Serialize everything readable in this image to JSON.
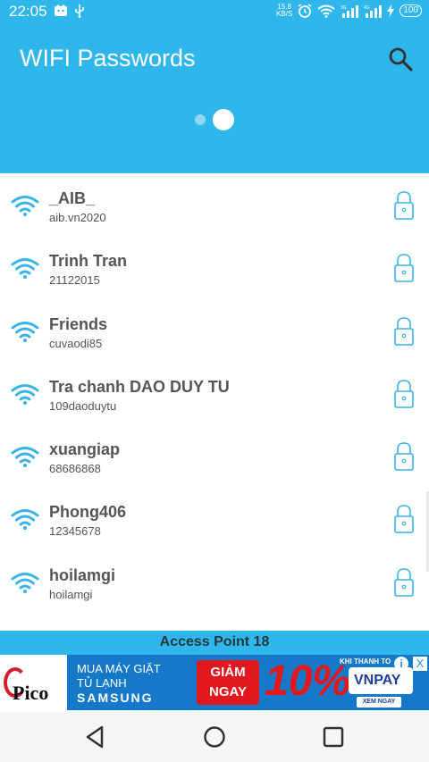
{
  "status_bar": {
    "time": "22:05",
    "net_speed_value": "15.8",
    "net_speed_unit": "KB/S",
    "battery": "100",
    "icons": [
      "notification-icon",
      "usb-icon",
      "alarm-icon",
      "wifi-icon",
      "signal-3g-icon",
      "signal-4g-icon",
      "charging-icon"
    ]
  },
  "app_bar": {
    "title": "WIFI Passwords",
    "pager": {
      "count": 2,
      "active_index": 1
    }
  },
  "networks": [
    {
      "name": "_AIB_",
      "password": "aib.vn2020"
    },
    {
      "name": "Trinh Tran",
      "password": "21122015"
    },
    {
      "name": "Friends",
      "password": "cuvaodi85"
    },
    {
      "name": "Tra chanh DAO DUY TU",
      "password": "109daoduytu"
    },
    {
      "name": "xuangiap",
      "password": "68686868"
    },
    {
      "name": "Phong406",
      "password": "12345678"
    },
    {
      "name": "hoilamgi",
      "password": "hoilamgi"
    }
  ],
  "footer": {
    "label": "Access Point 18"
  },
  "ad": {
    "logo": "Pico",
    "line1": "MUA MÁY GIẶT",
    "line2": "TỦ LẠNH",
    "brand": "SAMSUNG",
    "deal_line1": "GIẢM",
    "deal_line2": "NGAY",
    "percent": "10%",
    "pay_caption": "KHI THANH TO",
    "pay_name": "VNPAY",
    "cta": "XEM NGAY",
    "info_icon": "i",
    "close_icon": "X"
  },
  "colors": {
    "primary": "#2fb7ec",
    "text": "#555555",
    "icon_blue": "#3ab3e6"
  }
}
